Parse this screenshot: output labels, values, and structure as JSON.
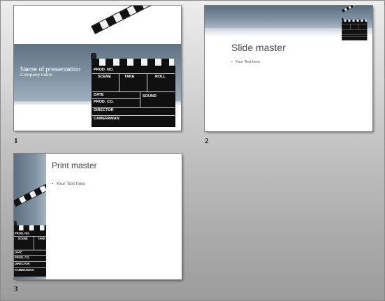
{
  "slides": [
    {
      "number": "1",
      "title": "Name of presentation",
      "subtitle": "Company name"
    },
    {
      "number": "2",
      "title": "Slide master",
      "bullet": "Your Text here"
    },
    {
      "number": "3",
      "title": "Print master",
      "bullet": "Your Text here"
    }
  ],
  "clapperboard": {
    "prod_no": "PROD. NO.",
    "scene": "SCENE",
    "take": "TAKE",
    "roll": "ROLL",
    "date": "DATE",
    "prod_co": "PROD. CO.",
    "sound": "SOUND",
    "director": "DIRECTOR",
    "cameraman": "CAMERAMAN"
  },
  "colors": {
    "workspace_top": "#ededed",
    "workspace_bottom": "#9c9c9c",
    "band_blue": "#6f8494"
  },
  "icons": {
    "clapperboard": "clapperboard-icon",
    "bullet": "bullet-dot"
  }
}
